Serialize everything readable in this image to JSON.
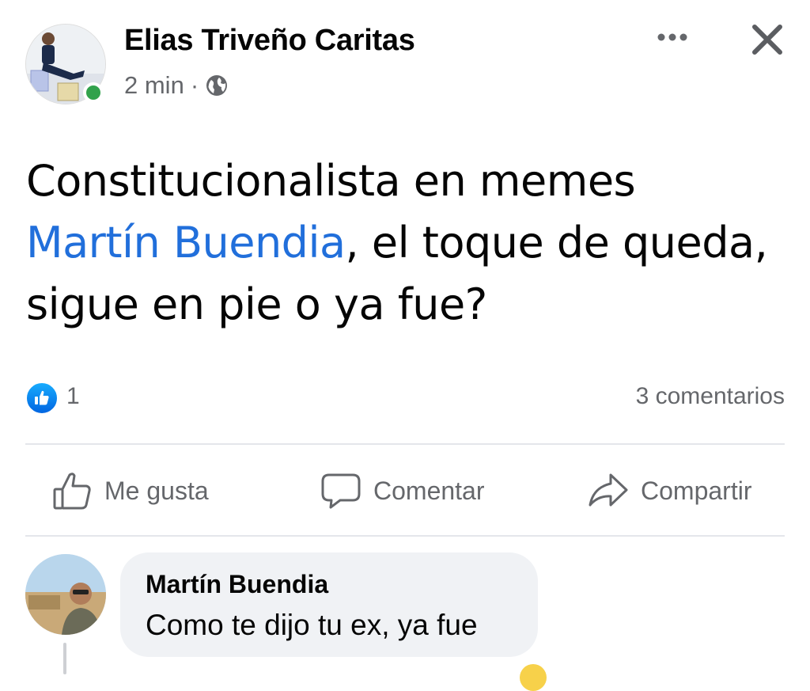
{
  "post": {
    "author": "Elias Triveño Caritas",
    "time": "2 min",
    "separator": "·",
    "text_before": "Constitucionalista en memes",
    "mention": "Martín Buendia",
    "text_after": ", el toque de queda, sigue en pie o ya fue?",
    "likes": "1",
    "comments": "3 comentarios"
  },
  "actions": {
    "like": "Me gusta",
    "comment": "Comentar",
    "share": "Compartir"
  },
  "comment": {
    "author": "Martín Buendia",
    "text": "Como te dijo tu ex, ya fue"
  },
  "icons": {
    "more": "more-horizontal-icon",
    "close": "close-icon",
    "audience": "globe-icon",
    "like": "thumbs-up-icon",
    "comment": "speech-bubble-icon",
    "share": "share-arrow-icon"
  },
  "colors": {
    "mention": "#216fdb",
    "like_badge": "#1877f2",
    "online": "#31a24c",
    "muted": "#65676b"
  }
}
